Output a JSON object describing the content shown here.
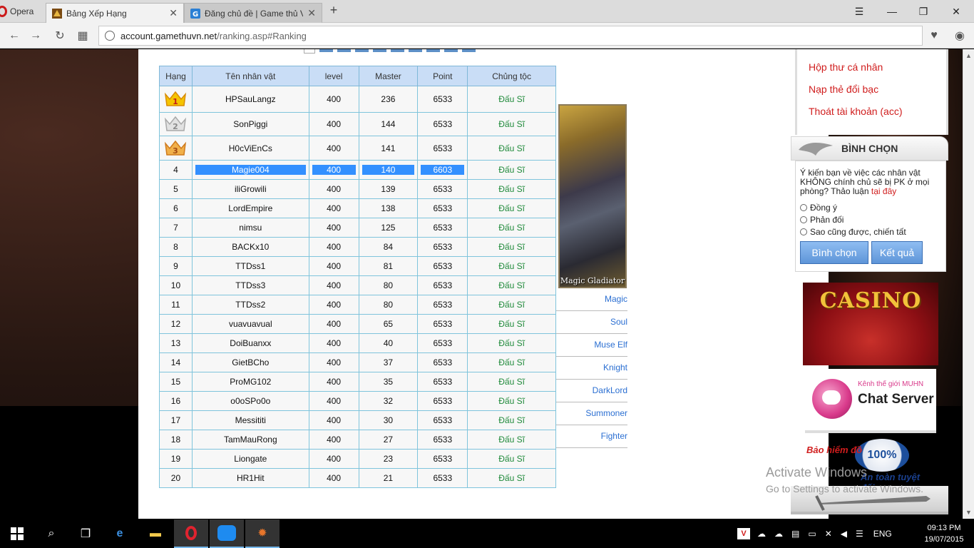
{
  "browser": {
    "menu_label": "Opera",
    "tabs": [
      {
        "title": "Bảng Xếp Hạng",
        "active": true
      },
      {
        "title": "Đăng chủ đề | Game thủ V",
        "active": false
      }
    ],
    "address": {
      "host": "account.gamethuvn.net",
      "path": "/ranking.asp#Ranking"
    }
  },
  "ranking": {
    "headers": [
      "Hạng",
      "Tên nhân vật",
      "level",
      "Master",
      "Point",
      "Chủng tộc"
    ],
    "rows": [
      {
        "rank": "1",
        "name": "HPSauLangz",
        "level": "400",
        "master": "236",
        "point": "6533",
        "race": "Đấu Sĩ"
      },
      {
        "rank": "2",
        "name": "SonPiggi",
        "level": "400",
        "master": "144",
        "point": "6533",
        "race": "Đấu Sĩ"
      },
      {
        "rank": "3",
        "name": "H0cViEnCs",
        "level": "400",
        "master": "141",
        "point": "6533",
        "race": "Đấu Sĩ"
      },
      {
        "rank": "4",
        "name": "Magie004",
        "level": "400",
        "master": "140",
        "point": "6603",
        "race": "Đấu Sĩ"
      },
      {
        "rank": "5",
        "name": "iliGrowili",
        "level": "400",
        "master": "139",
        "point": "6533",
        "race": "Đấu Sĩ"
      },
      {
        "rank": "6",
        "name": "LordEmpire",
        "level": "400",
        "master": "138",
        "point": "6533",
        "race": "Đấu Sĩ"
      },
      {
        "rank": "7",
        "name": "nimsu",
        "level": "400",
        "master": "125",
        "point": "6533",
        "race": "Đấu Sĩ"
      },
      {
        "rank": "8",
        "name": "BACKx10",
        "level": "400",
        "master": "84",
        "point": "6533",
        "race": "Đấu Sĩ"
      },
      {
        "rank": "9",
        "name": "TTDss1",
        "level": "400",
        "master": "81",
        "point": "6533",
        "race": "Đấu Sĩ"
      },
      {
        "rank": "10",
        "name": "TTDss3",
        "level": "400",
        "master": "80",
        "point": "6533",
        "race": "Đấu Sĩ"
      },
      {
        "rank": "11",
        "name": "TTDss2",
        "level": "400",
        "master": "80",
        "point": "6533",
        "race": "Đấu Sĩ"
      },
      {
        "rank": "12",
        "name": "vuavuavual",
        "level": "400",
        "master": "65",
        "point": "6533",
        "race": "Đấu Sĩ"
      },
      {
        "rank": "13",
        "name": "DoiBuanxx",
        "level": "400",
        "master": "40",
        "point": "6533",
        "race": "Đấu Sĩ"
      },
      {
        "rank": "14",
        "name": "GietBCho",
        "level": "400",
        "master": "37",
        "point": "6533",
        "race": "Đấu Sĩ"
      },
      {
        "rank": "15",
        "name": "ProMG102",
        "level": "400",
        "master": "35",
        "point": "6533",
        "race": "Đấu Sĩ"
      },
      {
        "rank": "16",
        "name": "o0oSPo0o",
        "level": "400",
        "master": "32",
        "point": "6533",
        "race": "Đấu Sĩ"
      },
      {
        "rank": "17",
        "name": "Messititi",
        "level": "400",
        "master": "30",
        "point": "6533",
        "race": "Đấu Sĩ"
      },
      {
        "rank": "18",
        "name": "TamMauRong",
        "level": "400",
        "master": "27",
        "point": "6533",
        "race": "Đấu Sĩ"
      },
      {
        "rank": "19",
        "name": "Liongate",
        "level": "400",
        "master": "23",
        "point": "6533",
        "race": "Đấu Sĩ"
      },
      {
        "rank": "20",
        "name": "HR1Hit",
        "level": "400",
        "master": "21",
        "point": "6533",
        "race": "Đấu Sĩ"
      }
    ]
  },
  "character": {
    "caption": "Magic Gladiator"
  },
  "classes": [
    "Magic",
    "Soul",
    "Muse Elf",
    "Knight",
    "DarkLord",
    "Summoner",
    "Fighter"
  ],
  "account_menu": [
    "Hộp thư cá nhân",
    "Nạp thẻ đổi bạc",
    "Thoát tài khoản (acc)"
  ],
  "poll": {
    "title": "BÌNH CHỌN",
    "question": "Ý kiến bạn về việc các nhân vật KHÔNG chính chủ sẽ bị PK ở mọi phòng? Thảo luận",
    "question_link": "tại đây",
    "options": [
      "Đồng ý",
      "Phản đối",
      "Sao cũng được, chiến tất"
    ],
    "vote_label": "Bình chọn",
    "result_label": "Kết quả"
  },
  "banners": {
    "casino": "CASINO",
    "chat_small": "Kênh thế giới MUHN",
    "chat_title": "Chat Server",
    "insure_top": "Bảo hiểm đồ",
    "insure_seal": "100%",
    "insure_bottom": "An toàn tuyệt đối"
  },
  "watermark": {
    "line1": "Activate Windows",
    "line2": "Go to Settings to activate Windows."
  },
  "taskbar": {
    "language": "ENG",
    "time": "09:13 PM",
    "date": "19/07/2015"
  },
  "colors": {
    "accent_blue": "#3390ff",
    "link_red": "#d01d1d",
    "race_green": "#1f8a3a"
  }
}
